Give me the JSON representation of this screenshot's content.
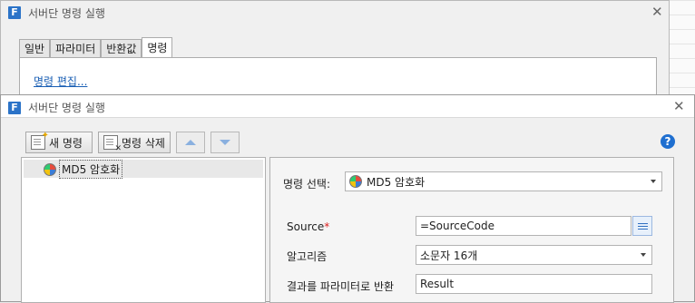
{
  "background_dialog": {
    "title": "서버단 명령 실행",
    "tabs": [
      {
        "label": "일반"
      },
      {
        "label": "파라미터"
      },
      {
        "label": "반환값"
      },
      {
        "label": "명령",
        "active": true
      }
    ],
    "link": "명령 편집..."
  },
  "dialog": {
    "title": "서버단 명령 실행",
    "toolbar": {
      "new_label": "새 명령",
      "delete_label": "명령 삭제"
    },
    "command_list": [
      {
        "label": "MD5 암호화",
        "icon": "md5-icon",
        "selected": true
      }
    ],
    "form": {
      "command_select_label": "명령 선택:",
      "command_select_value": "MD5 암호화",
      "source_label": "Source",
      "source_required": "*",
      "source_value": "=SourceCode",
      "algorithm_label": "알고리즘",
      "algorithm_value": "소문자 16개",
      "result_label": "결과를 파라미터로 반환",
      "result_value": "Result"
    }
  },
  "colors": {
    "accent": "#2b73c8",
    "link": "#1a5fb4",
    "required": "#dd2222"
  }
}
